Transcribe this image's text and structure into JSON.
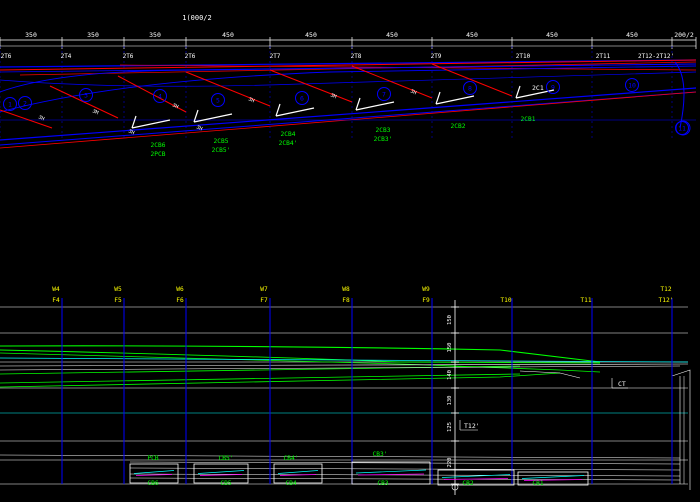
{
  "top_drawing": {
    "title": "1(000/2",
    "dimensions": [
      "350",
      "350",
      "350",
      "450",
      "450",
      "450",
      "450",
      "450",
      "450",
      "200/2"
    ],
    "grid_labels": [
      "2T6",
      "2T4",
      "2T6",
      "2T6",
      "2T7",
      "2T8",
      "2T9",
      "2T10",
      "2T11",
      "2T12-2T12'"
    ],
    "circle_numbers": [
      "1",
      "2",
      "3",
      "4",
      "5",
      "6",
      "7",
      "8",
      "9",
      "10",
      "11"
    ],
    "brace_labels": [
      {
        "line1": "2CB6",
        "line2": "2PCB"
      },
      {
        "line1": "2CB5",
        "line2": "2CB5'"
      },
      {
        "line1": "2CB4",
        "line2": "2CB4'"
      },
      {
        "line1": "2CB3",
        "line2": "2CB3'"
      },
      {
        "line1": "2CB2",
        "line2": ""
      },
      {
        "line1": "2CB1",
        "line2": ""
      }
    ],
    "extra_label": "2C1",
    "slope_labels": [
      "3H",
      "3M",
      "3H",
      "3H",
      "3M",
      "3H",
      "3H",
      "3H"
    ],
    "colors": {
      "axis": "#0000ff",
      "beam": "#ff0000",
      "dim": "#ffffff",
      "brace": "#00ff00"
    }
  },
  "bottom_drawing": {
    "axis_top": [
      "W4",
      "W5",
      "W6",
      "W7",
      "W8",
      "W9",
      "",
      "",
      "T12"
    ],
    "axis_bottom": [
      "F4",
      "F5",
      "F6",
      "F7",
      "F8",
      "F9",
      "T10",
      "T11",
      "T12'"
    ],
    "vertical_dims": [
      "150",
      "150",
      "140",
      "130",
      "125",
      "220"
    ],
    "labels": {
      "ct": "CT",
      "t12p": "T12'"
    },
    "segment_top_labels": [
      "PCB",
      "CB5'",
      "CB4'",
      "CB3'"
    ],
    "segment_bottom_labels": [
      "CB6",
      "CB5",
      "CB4",
      "CB3",
      "CB2",
      "CB1"
    ],
    "colors": {
      "axis": "#0000ff",
      "chord": "#00ff00",
      "cyan": "#00ffff",
      "magenta": "#ff00ff",
      "line": "#ffffff",
      "label": "#ffff00"
    }
  }
}
